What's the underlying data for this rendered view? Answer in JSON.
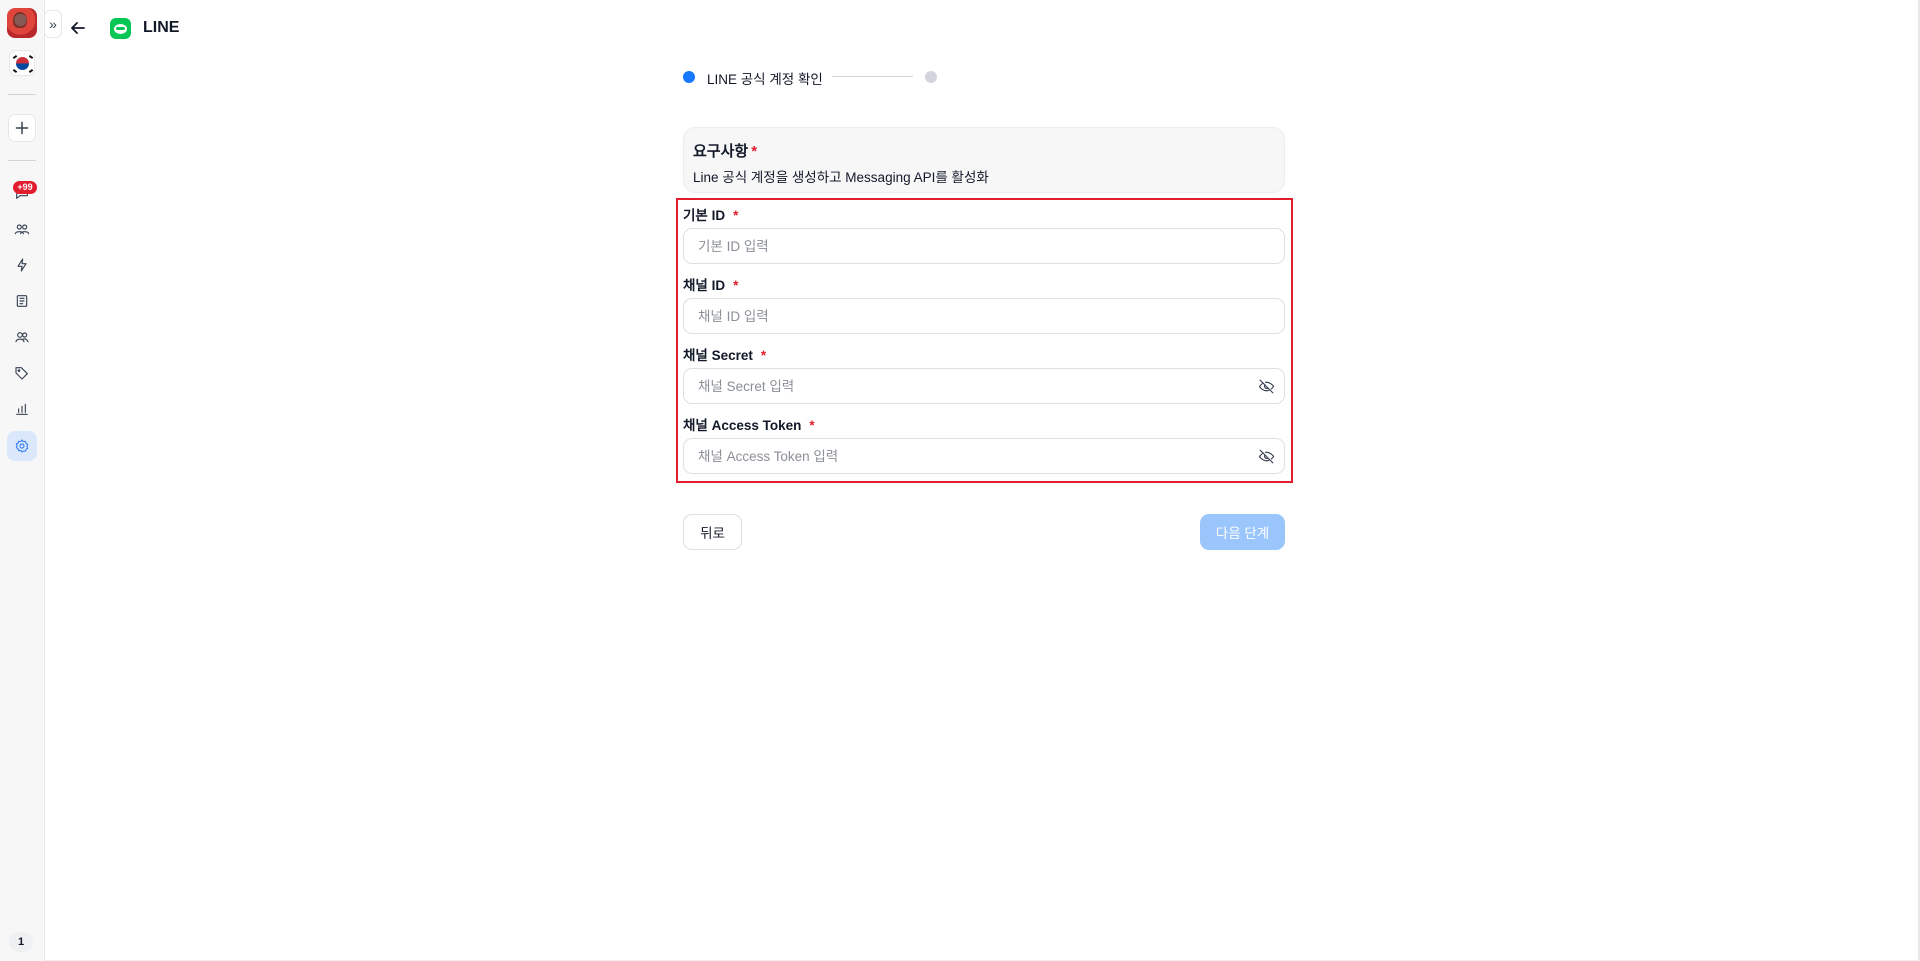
{
  "app": {
    "title": "LINE"
  },
  "sidebar": {
    "expand_icon": "chevron-double-right-icon",
    "notification_badge": "+99",
    "page_number": "1",
    "items": [
      {
        "name": "inbox",
        "icon": "inbox-icon"
      },
      {
        "name": "contacts",
        "icon": "users-icon"
      },
      {
        "name": "automation",
        "icon": "bolt-icon"
      },
      {
        "name": "broadcast",
        "icon": "document-icon"
      },
      {
        "name": "team",
        "icon": "team-icon"
      },
      {
        "name": "tags",
        "icon": "tag-icon"
      },
      {
        "name": "analytics",
        "icon": "chart-icon"
      },
      {
        "name": "settings",
        "icon": "gear-icon",
        "active": true
      }
    ]
  },
  "stepper": {
    "steps": [
      {
        "label": "LINE 공식 계정 확인",
        "active": true
      },
      {
        "label": "",
        "active": false
      }
    ]
  },
  "requirements": {
    "title": "요구사항",
    "required_mark": "*",
    "description": "Line 공식 계정을 생성하고 Messaging API를 활성화"
  },
  "form": {
    "fields": [
      {
        "label": "기본 ID",
        "required_mark": "*",
        "placeholder": "기본 ID 입력",
        "value": "",
        "secret": false
      },
      {
        "label": "채널 ID",
        "required_mark": "*",
        "placeholder": "채널 ID 입력",
        "value": "",
        "secret": false
      },
      {
        "label": "채널 Secret",
        "required_mark": "*",
        "placeholder": "채널 Secret 입력",
        "value": "",
        "secret": true
      },
      {
        "label": "채널 Access Token",
        "required_mark": "*",
        "placeholder": "채널 Access Token 입력",
        "value": "",
        "secret": true
      }
    ]
  },
  "actions": {
    "back_label": "뒤로",
    "next_label": "다음 단계",
    "next_disabled": true
  },
  "colors": {
    "primary": "#1677ff",
    "primary_disabled": "#9ac6fb",
    "required": "#e11d2e",
    "line_brand": "#06c755",
    "highlight_border": "#e11d2e"
  }
}
